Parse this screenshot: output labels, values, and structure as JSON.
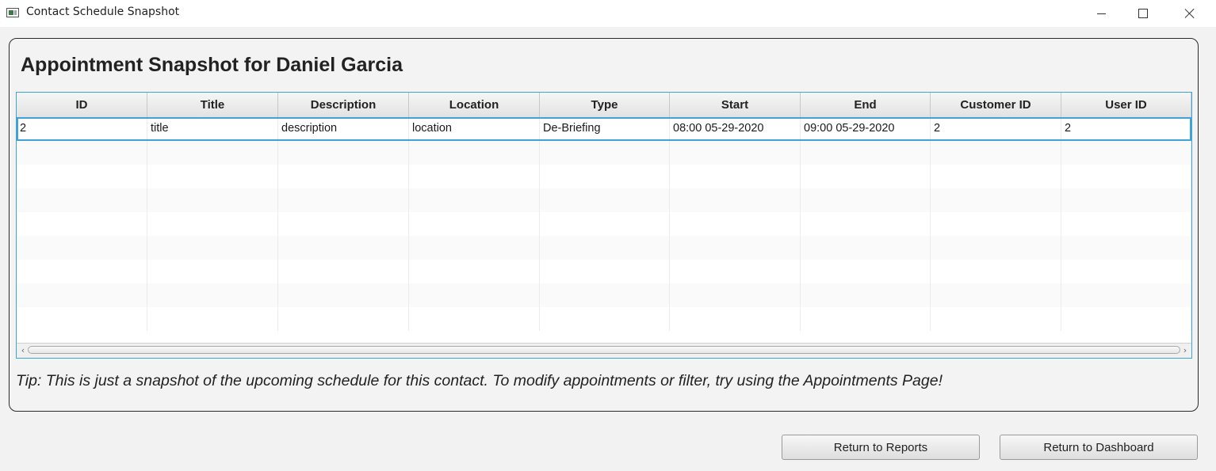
{
  "window": {
    "title": "Contact Schedule Snapshot"
  },
  "heading": "Appointment Snapshot for Daniel Garcia",
  "table": {
    "columns": [
      "ID",
      "Title",
      "Description",
      "Location",
      "Type",
      "Start",
      "End",
      "Customer ID",
      "User ID"
    ],
    "rows": [
      [
        "2",
        "title",
        "description",
        "location",
        "De-Briefing",
        "08:00 05-29-2020",
        "09:00 05-29-2020",
        "2",
        "2"
      ]
    ]
  },
  "tip": "Tip: This is just a snapshot of the upcoming schedule for this contact. To modify appointments or filter, try using the Appointments Page!",
  "buttons": {
    "reports": "Return to Reports",
    "dashboard": "Return to Dashboard"
  },
  "colors": {
    "selection": "#3ea3d6"
  },
  "icons": {
    "app": "app-icon",
    "minimize": "minimize-icon",
    "maximize": "maximize-icon",
    "close": "close-icon"
  }
}
